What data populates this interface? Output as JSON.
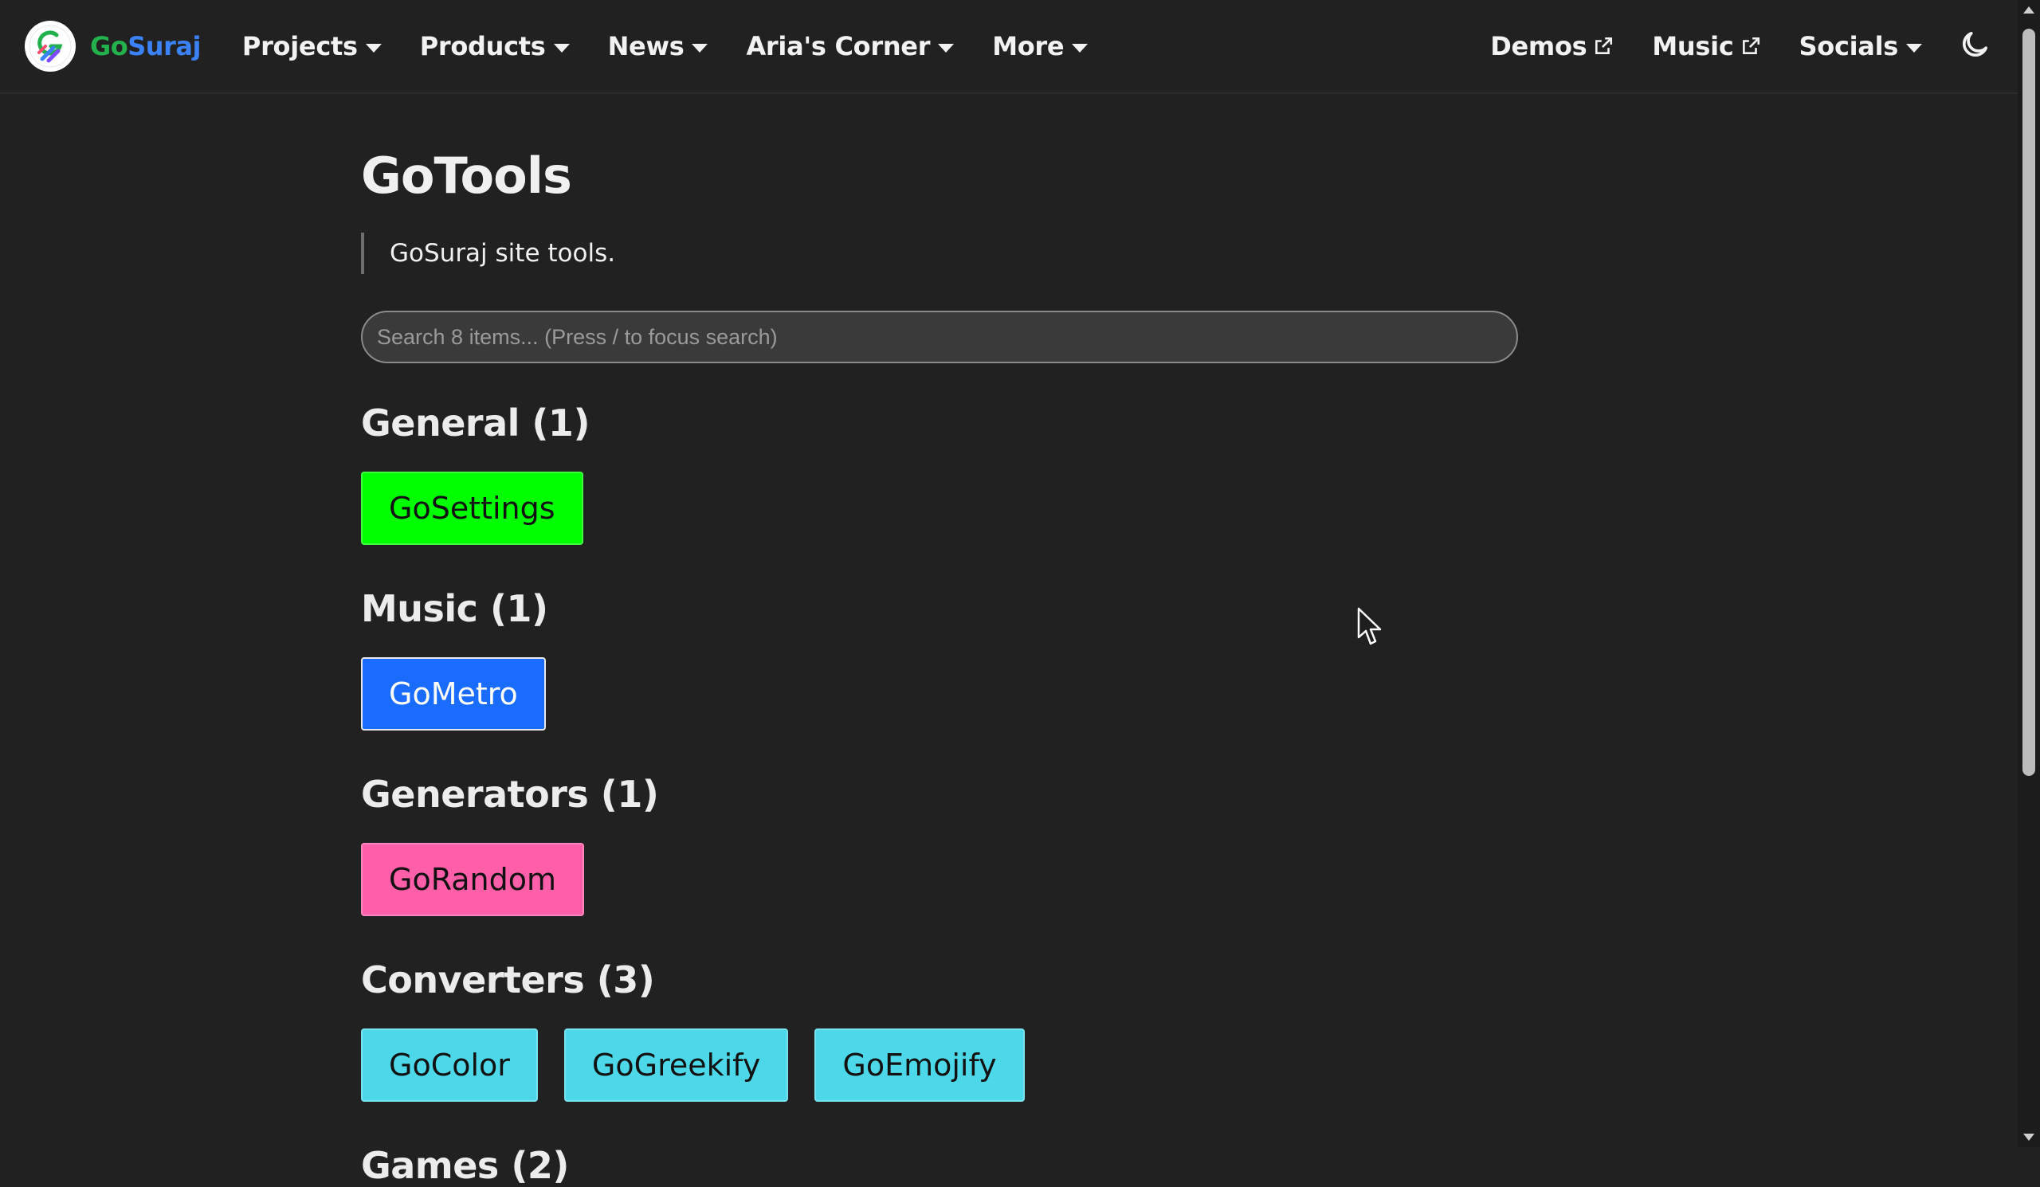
{
  "navbar": {
    "brand": {
      "go": "Go",
      "suraj": "Suraj"
    },
    "menu_left": [
      {
        "label": "Projects"
      },
      {
        "label": "Products"
      },
      {
        "label": "News"
      },
      {
        "label": "Aria's Corner"
      },
      {
        "label": "More"
      }
    ],
    "menu_right": [
      {
        "label": "Demos",
        "icon": "external-link-icon"
      },
      {
        "label": "Music",
        "icon": "external-link-icon"
      },
      {
        "label": "Socials",
        "icon": "caret-down-icon"
      }
    ],
    "theme_toggle_icon": "moon-icon"
  },
  "page": {
    "title": "GoTools",
    "subtitle": "GoSuraj site tools.",
    "search": {
      "placeholder": "Search 8 items... (Press / to focus search)",
      "value": ""
    }
  },
  "categories": [
    {
      "heading": "General (1)",
      "tools": [
        {
          "label": "GoSettings",
          "color": "#00ff00"
        }
      ]
    },
    {
      "heading": "Music (1)",
      "tools": [
        {
          "label": "GoMetro",
          "color": "#1a6cff"
        }
      ]
    },
    {
      "heading": "Generators (1)",
      "tools": [
        {
          "label": "GoRandom",
          "color": "#ff5ea8"
        }
      ]
    },
    {
      "heading": "Converters (3)",
      "tools": [
        {
          "label": "GoColor",
          "color": "#4dd8ea"
        },
        {
          "label": "GoGreekify",
          "color": "#4dd8ea"
        },
        {
          "label": "GoEmojify",
          "color": "#4dd8ea"
        }
      ]
    },
    {
      "heading": "Games (2)",
      "tools": []
    }
  ],
  "colors": {
    "background": "#212121",
    "brand_green": "#22b14c",
    "brand_blue": "#3b82f6"
  }
}
